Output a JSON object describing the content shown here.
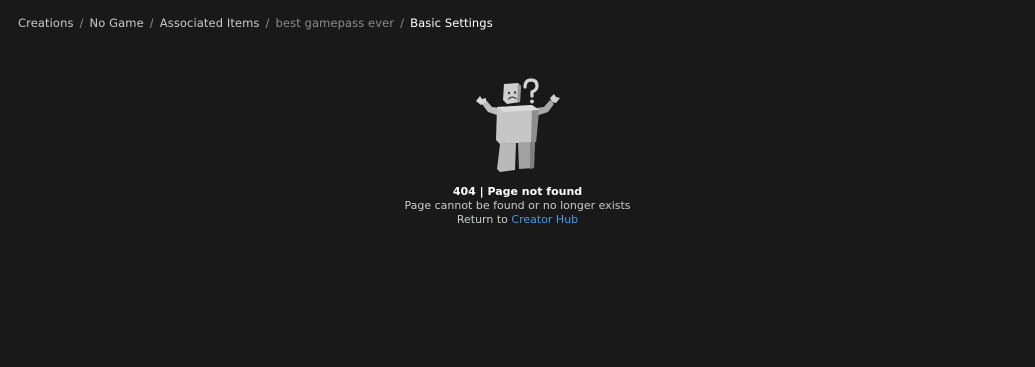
{
  "breadcrumb": {
    "items": [
      {
        "label": "Creations"
      },
      {
        "label": "No Game"
      },
      {
        "label": "Associated Items"
      },
      {
        "label": "best gamepass ever"
      },
      {
        "label": "Basic Settings"
      }
    ],
    "separator": "/"
  },
  "error": {
    "figure_icon": "confused-robloxian-icon",
    "title": "404 | Page not found",
    "description": "Page cannot be found or no longer exists",
    "return_prefix": "Return to",
    "return_link_label": "Creator Hub"
  },
  "colors": {
    "background": "#191919",
    "link": "#3b9cf0"
  }
}
